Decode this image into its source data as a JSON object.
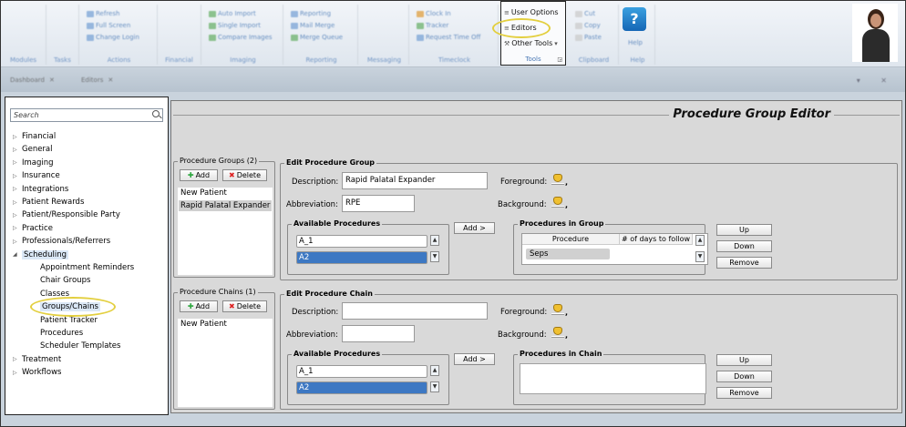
{
  "ribbon": {
    "groups": [
      {
        "label": "Modules",
        "items": []
      },
      {
        "label": "Tasks",
        "items": []
      },
      {
        "label": "Actions",
        "items": [
          "Refresh",
          "Full Screen",
          "Change Login"
        ]
      },
      {
        "label": "Financial",
        "items": []
      },
      {
        "label": "Imaging",
        "items": [
          "Auto Import",
          "Single Import",
          "Compare Images"
        ]
      },
      {
        "label": "Reporting",
        "items": [
          "Reporting",
          "Mail Merge",
          "Merge Queue"
        ]
      },
      {
        "label": "Messaging",
        "items": []
      },
      {
        "label": "Timeclock",
        "items": [
          "Clock In",
          "Tracker",
          "Request Time Off"
        ]
      },
      {
        "label": "Clipboard",
        "items": [
          "Cut",
          "Copy",
          "Paste"
        ]
      },
      {
        "label": "Help",
        "items": [
          "Help"
        ]
      }
    ],
    "tools": {
      "label": "Tools",
      "items": [
        "User Options",
        "Editors",
        "Other Tools"
      ]
    }
  },
  "tabs": [
    {
      "label": "Dashboard",
      "close": "✕"
    },
    {
      "label": "Editors",
      "close": "✕"
    }
  ],
  "window_controls": "▾ ✕",
  "nav": {
    "search_placeholder": "Search",
    "tree": [
      {
        "label": "Financial",
        "level": 0,
        "arrow": "▷"
      },
      {
        "label": "General",
        "level": 0,
        "arrow": "▷"
      },
      {
        "label": "Imaging",
        "level": 0,
        "arrow": "▷"
      },
      {
        "label": "Insurance",
        "level": 0,
        "arrow": "▷"
      },
      {
        "label": "Integrations",
        "level": 0,
        "arrow": "▷"
      },
      {
        "label": "Patient Rewards",
        "level": 0,
        "arrow": "▷"
      },
      {
        "label": "Patient/Responsible Party",
        "level": 0,
        "arrow": "▷"
      },
      {
        "label": "Practice",
        "level": 0,
        "arrow": "▷"
      },
      {
        "label": "Professionals/Referrers",
        "level": 0,
        "arrow": "▷"
      },
      {
        "label": "Scheduling",
        "level": 0,
        "arrow": "◢",
        "selected": true
      },
      {
        "label": "Appointment Reminders",
        "level": 1
      },
      {
        "label": "Chair Groups",
        "level": 1
      },
      {
        "label": "Classes",
        "level": 1
      },
      {
        "label": "Groups/Chains",
        "level": 1,
        "selected": true
      },
      {
        "label": "Patient Tracker",
        "level": 1
      },
      {
        "label": "Procedures",
        "level": 1
      },
      {
        "label": "Scheduler Templates",
        "level": 1
      },
      {
        "label": "Treatment",
        "level": 0,
        "arrow": "▷"
      },
      {
        "label": "Workflows",
        "level": 0,
        "arrow": "▷"
      }
    ]
  },
  "editor": {
    "title": "Procedure Group Editor",
    "groups_panel": {
      "legend": "Procedure Groups (2)",
      "add_label": "Add",
      "delete_label": "Delete",
      "items": [
        "New Patient",
        "Rapid Palatal Expander"
      ],
      "selected_index": 1
    },
    "edit_group": {
      "legend": "Edit Procedure Group",
      "description_label": "Description:",
      "description_value": "Rapid Palatal Expander",
      "abbreviation_label": "Abbreviation:",
      "abbreviation_value": "RPE",
      "foreground_label": "Foreground:",
      "background_label": "Background:",
      "color_suffix": ",",
      "available_legend": "Available Procedures",
      "available_items": [
        "A_1",
        "A2"
      ],
      "add_button": "Add >",
      "in_group_legend": "Procedures in Group",
      "grid_headers": [
        "Procedure",
        "# of days to follow"
      ],
      "grid_rows": [
        "Seps"
      ],
      "up": "Up",
      "down": "Down",
      "remove": "Remove"
    },
    "chains_panel": {
      "legend": "Procedure Chains (1)",
      "add_label": "Add",
      "delete_label": "Delete",
      "items": [
        "New Patient"
      ]
    },
    "edit_chain": {
      "legend": "Edit Procedure Chain",
      "description_label": "Description:",
      "description_value": "",
      "abbreviation_label": "Abbreviation:",
      "abbreviation_value": "",
      "foreground_label": "Foreground:",
      "background_label": "Background:",
      "color_suffix": ",",
      "available_legend": "Available Procedures",
      "available_items": [
        "A_1",
        "A2"
      ],
      "add_button": "Add >",
      "in_chain_legend": "Procedures in Chain",
      "up": "Up",
      "down": "Down",
      "remove": "Remove"
    }
  },
  "colors": {
    "highlight_ring": "#e3cf3f",
    "selection_blue": "#3d78c3"
  }
}
